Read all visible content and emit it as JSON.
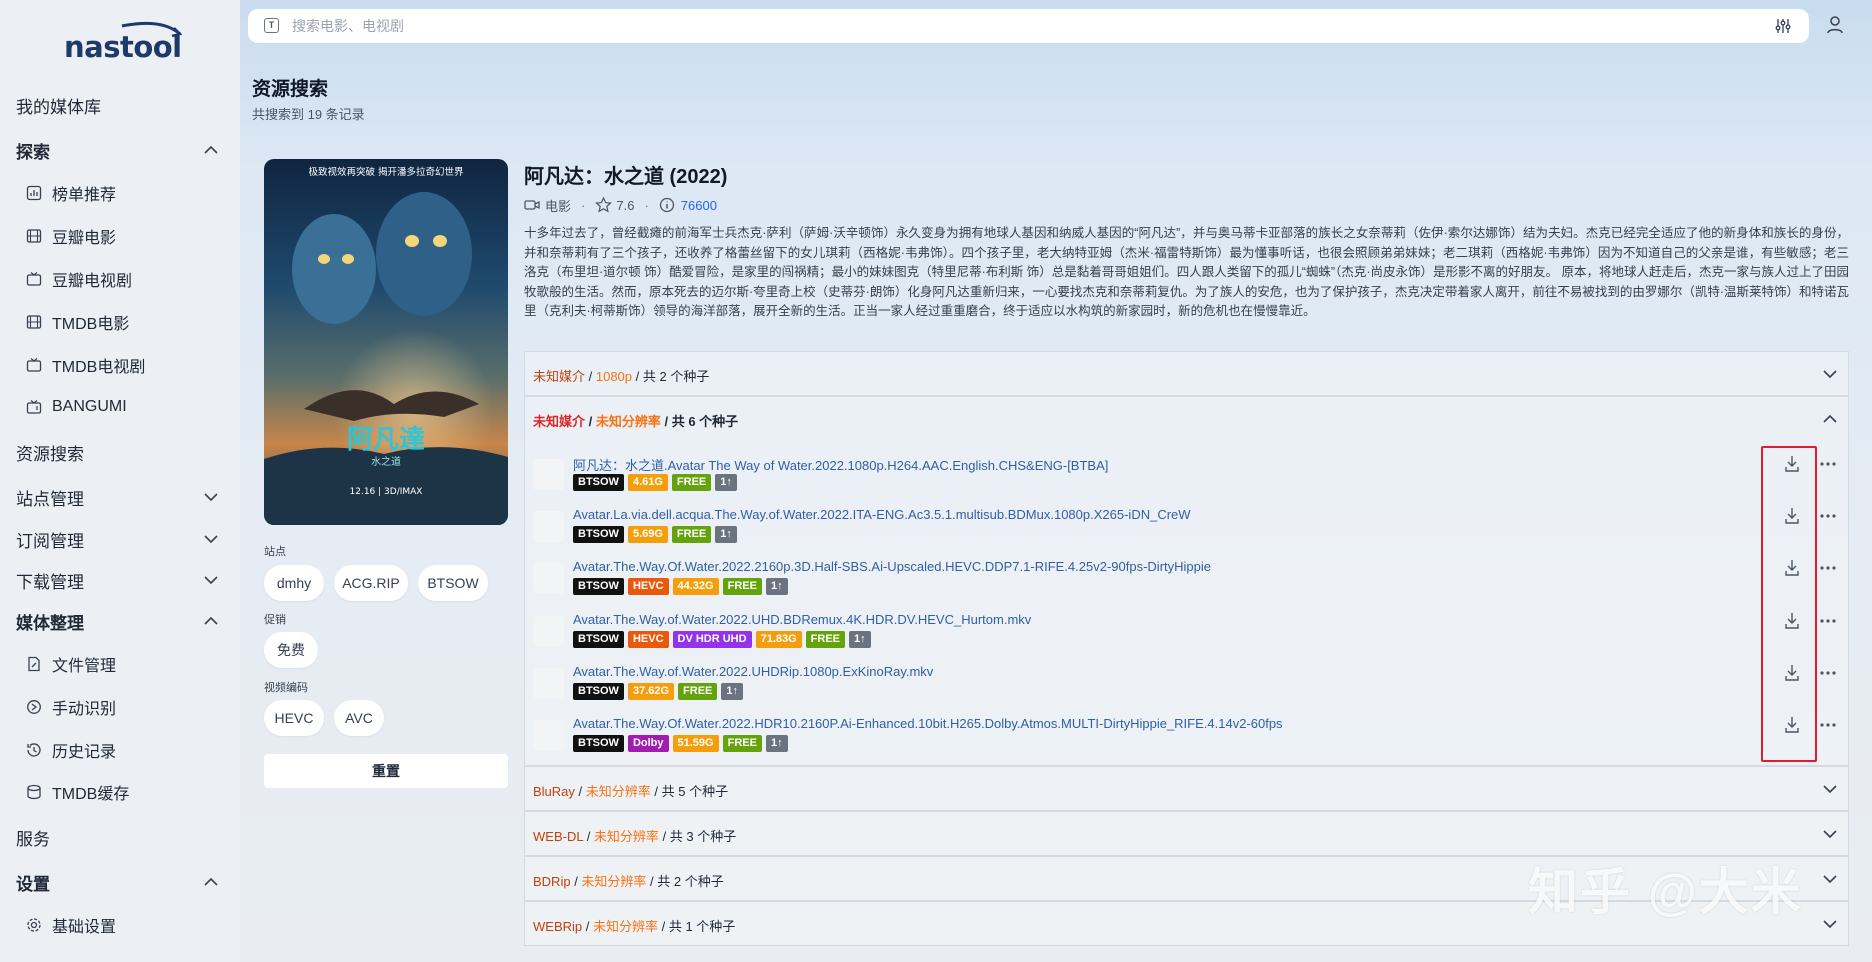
{
  "app": {
    "logo_text": "nastool"
  },
  "sidebar": {
    "items": [
      {
        "label": "我的媒体库"
      },
      {
        "label": "探索"
      },
      {
        "label": "榜单推荐"
      },
      {
        "label": "豆瓣电影"
      },
      {
        "label": "豆瓣电视剧"
      },
      {
        "label": "TMDB电影"
      },
      {
        "label": "TMDB电视剧"
      },
      {
        "label": "BANGUMI"
      },
      {
        "label": "资源搜索"
      },
      {
        "label": "站点管理"
      },
      {
        "label": "订阅管理"
      },
      {
        "label": "下载管理"
      },
      {
        "label": "媒体整理"
      },
      {
        "label": "文件管理"
      },
      {
        "label": "手动识别"
      },
      {
        "label": "历史记录"
      },
      {
        "label": "TMDB缓存"
      },
      {
        "label": "服务"
      },
      {
        "label": "设置"
      },
      {
        "label": "基础设置"
      }
    ]
  },
  "search": {
    "placeholder": "搜索电影、电视剧",
    "value": ""
  },
  "page": {
    "title": "资源搜索",
    "subtitle": "共搜索到 19 条记录"
  },
  "poster": {
    "top_text": "极致视效再突破  揭开潘多拉奇幻世界",
    "title_art": "阿凡達",
    "subtitle_art": "水之道",
    "date_text": "12.16 | 3D/IMAX"
  },
  "filters": {
    "site_label": "站点",
    "sites": [
      "dmhy",
      "ACG.RIP",
      "BTSOW"
    ],
    "promo_label": "促销",
    "promos": [
      "免费"
    ],
    "codec_label": "视频编码",
    "codecs": [
      "HEVC",
      "AVC"
    ],
    "reset_label": "重置"
  },
  "movie": {
    "title": "阿凡达：水之道 (2022)",
    "type": "电影",
    "rating": "7.6",
    "tmdb_id": "76600",
    "overview": "十多年过去了，曾经截瘫的前海军士兵杰克·萨利（萨姆·沃辛顿饰）永久变身为拥有地球人基因和纳威人基因的“阿凡达”，并与奥马蒂卡亚部落的族长之女奈蒂莉（佐伊·索尔达娜饰）结为夫妇。杰克已经完全适应了他的新身体和族长的身份，并和奈蒂莉有了三个孩子，还收养了格蕾丝留下的女儿琪莉（西格妮·韦弗饰）。四个孩子里，老大纳特亚姆（杰米·福雷特斯饰）最为懂事听话，也很会照顾弟弟妹妹；老二琪莉（西格妮·韦弗饰）因为不知道自己的父亲是谁，有些敏感；老三洛克（布里坦·道尔顿 饰）酷爱冒险，是家里的闯祸精；最小的妹妹图克（特里尼蒂·布利斯 饰）总是黏着哥哥姐姐们。四人跟人类留下的孤儿“蜘蛛”（杰克·尚皮永饰）是形影不离的好朋友。 原本，将地球人赶走后，杰克一家与族人过上了田园牧歌般的生活。然而，原本死去的迈尔斯·夸里奇上校（史蒂芬·朗饰）化身阿凡达重新归来，一心要找杰克和奈蒂莉复仇。为了族人的安危，也为了保护孩子，杰克决定带着家人离开，前往不易被找到的由罗娜尔（凯特·温斯莱特饰）和特诺瓦里（克利夫·柯蒂斯饰）领导的海洋部落，展开全新的生活。正当一家人经过重重磨合，终于适应以水构筑的新家园时，新的危机也在慢慢靠近。"
  },
  "groups": [
    {
      "media": "未知媒介",
      "resolution": "1080p",
      "count": "共 2 个种子",
      "expanded": false
    },
    {
      "media": "未知媒介",
      "resolution": "未知分辨率",
      "count": "共 6 个种子",
      "expanded": true
    },
    {
      "media": "BluRay",
      "resolution": "未知分辨率",
      "count": "共 5 个种子",
      "expanded": false
    },
    {
      "media": "WEB-DL",
      "resolution": "未知分辨率",
      "count": "共 3 个种子",
      "expanded": false
    },
    {
      "media": "BDRip",
      "resolution": "未知分辨率",
      "count": "共 2 个种子",
      "expanded": false
    },
    {
      "media": "WEBRip",
      "resolution": "未知分辨率",
      "count": "共 1 个种子",
      "expanded": false
    }
  ],
  "torrents": [
    {
      "title": "阿凡达：水之道.Avatar The Way of Water.2022.1080p.H264.AAC.English.CHS&ENG-[BTBA]",
      "tags": [
        {
          "text": "BTSOW",
          "color": "#111111"
        },
        {
          "text": "4.61G",
          "color": "#f59e0b"
        },
        {
          "text": "FREE",
          "color": "#65a30d"
        },
        {
          "text": "1↑",
          "color": "#6b7280"
        }
      ]
    },
    {
      "title": "Avatar.La.via.dell.acqua.The.Way.of.Water.2022.ITA-ENG.Ac3.5.1.multisub.BDMux.1080p.X265-iDN_CreW",
      "tags": [
        {
          "text": "BTSOW",
          "color": "#111111"
        },
        {
          "text": "5.69G",
          "color": "#f59e0b"
        },
        {
          "text": "FREE",
          "color": "#65a30d"
        },
        {
          "text": "1↑",
          "color": "#6b7280"
        }
      ]
    },
    {
      "title": "Avatar.The.Way.Of.Water.2022.2160p.3D.Half-SBS.Ai-Upscaled.HEVC.DDP7.1-RIFE.4.25v2-90fps-DirtyHippie",
      "tags": [
        {
          "text": "BTSOW",
          "color": "#111111"
        },
        {
          "text": "HEVC",
          "color": "#ea580c"
        },
        {
          "text": "44.32G",
          "color": "#f59e0b"
        },
        {
          "text": "FREE",
          "color": "#65a30d"
        },
        {
          "text": "1↑",
          "color": "#6b7280"
        }
      ]
    },
    {
      "title": "Avatar.The.Way.of.Water.2022.UHD.BDRemux.4K.HDR.DV.HEVC_Hurtom.mkv",
      "tags": [
        {
          "text": "BTSOW",
          "color": "#111111"
        },
        {
          "text": "HEVC",
          "color": "#ea580c"
        },
        {
          "text": "DV HDR UHD",
          "color": "#9333ea"
        },
        {
          "text": "71.83G",
          "color": "#f59e0b"
        },
        {
          "text": "FREE",
          "color": "#65a30d"
        },
        {
          "text": "1↑",
          "color": "#6b7280"
        }
      ]
    },
    {
      "title": "Avatar.The.Way.of.Water.2022.UHDRip.1080p.ExKinoRay.mkv",
      "tags": [
        {
          "text": "BTSOW",
          "color": "#111111"
        },
        {
          "text": "37.62G",
          "color": "#f59e0b"
        },
        {
          "text": "FREE",
          "color": "#65a30d"
        },
        {
          "text": "1↑",
          "color": "#6b7280"
        }
      ]
    },
    {
      "title": "Avatar.The.Way.Of.Water.2022.HDR10.2160P.Ai-Enhanced.10bit.H265.Dolby.Atmos.MULTI-DirtyHippie_RIFE.4.14v2-60fps",
      "tags": [
        {
          "text": "BTSOW",
          "color": "#111111"
        },
        {
          "text": "Dolby",
          "color": "#a21caf"
        },
        {
          "text": "51.59G",
          "color": "#f59e0b"
        },
        {
          "text": "FREE",
          "color": "#65a30d"
        },
        {
          "text": "1↑",
          "color": "#6b7280"
        }
      ]
    }
  ],
  "watermark": "知乎 @大米",
  "colors": {
    "accent": "#2f5fa5",
    "highlight_box": "#e11d2d",
    "media_text": "#c2410c",
    "resolution_text": "#f97316"
  }
}
